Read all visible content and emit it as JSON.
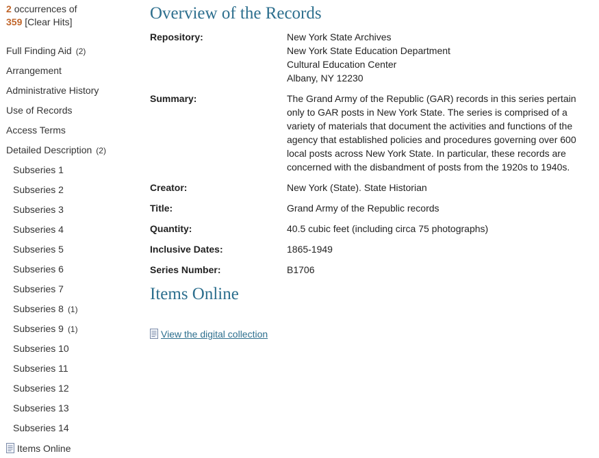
{
  "hits": {
    "count": "2",
    "occurrences_text": "occurrences of",
    "total": "359",
    "clear_label": "[Clear Hits]"
  },
  "nav": {
    "items": [
      {
        "label": "Full Finding Aid",
        "count": "(2)"
      },
      {
        "label": "Arrangement",
        "count": ""
      },
      {
        "label": "Administrative History",
        "count": ""
      },
      {
        "label": "Use of Records",
        "count": ""
      },
      {
        "label": "Access Terms",
        "count": ""
      },
      {
        "label": "Detailed Description",
        "count": "(2)"
      }
    ],
    "subseries": [
      {
        "label": "Subseries 1",
        "count": ""
      },
      {
        "label": "Subseries 2",
        "count": ""
      },
      {
        "label": "Subseries 3",
        "count": ""
      },
      {
        "label": "Subseries 4",
        "count": ""
      },
      {
        "label": "Subseries 5",
        "count": ""
      },
      {
        "label": "Subseries 6",
        "count": ""
      },
      {
        "label": "Subseries 7",
        "count": ""
      },
      {
        "label": "Subseries 8",
        "count": "(1)"
      },
      {
        "label": "Subseries 9",
        "count": "(1)"
      },
      {
        "label": "Subseries 10",
        "count": ""
      },
      {
        "label": "Subseries 11",
        "count": ""
      },
      {
        "label": "Subseries 12",
        "count": ""
      },
      {
        "label": "Subseries 13",
        "count": ""
      },
      {
        "label": "Subseries 14",
        "count": ""
      }
    ],
    "items_online": "Items Online"
  },
  "overview": {
    "title": "Overview of the Records",
    "repository": {
      "label": "Repository:",
      "lines": [
        "New York State Archives",
        "New York State Education Department",
        "Cultural Education Center",
        "Albany, NY 12230"
      ]
    },
    "summary": {
      "label": "Summary:",
      "text": "The Grand Army of the Republic (GAR) records in this series pertain only to GAR posts in New York State. The series is comprised of a variety of materials that document the activities and functions of the agency that established policies and procedures governing over 600 local posts across New York State. In particular, these records are concerned with the disbandment of posts from the 1920s to 1940s."
    },
    "creator": {
      "label": "Creator:",
      "value": "New York (State). State Historian"
    },
    "title_field": {
      "label": "Title:",
      "value": "Grand Army of the Republic records"
    },
    "quantity": {
      "label": "Quantity:",
      "value": "40.5 cubic feet (including circa 75 photographs)"
    },
    "dates": {
      "label": "Inclusive Dates:",
      "value": "1865-1949"
    },
    "series_number": {
      "label": "Series Number:",
      "value": "B1706"
    }
  },
  "items_online": {
    "title": "Items Online",
    "link_label": "View the digital collection"
  },
  "icons": {
    "document": "document-icon"
  }
}
